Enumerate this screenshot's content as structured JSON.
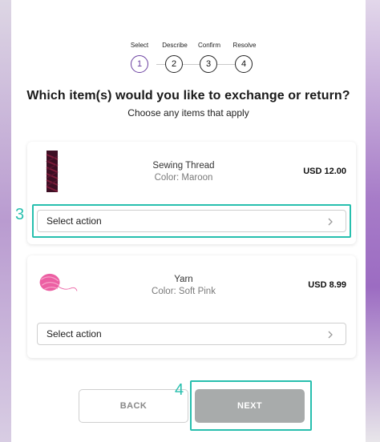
{
  "stepper": {
    "steps": [
      {
        "label": "Select",
        "number": "1",
        "active": true
      },
      {
        "label": "Describe",
        "number": "2",
        "active": false
      },
      {
        "label": "Confirm",
        "number": "3",
        "active": false
      },
      {
        "label": "Resolve",
        "number": "4",
        "active": false
      }
    ]
  },
  "page": {
    "title": "Which item(s) would you like to exchange or return?",
    "subtitle": "Choose any items that apply"
  },
  "items": [
    {
      "name": "Sewing Thread",
      "color": "Color: Maroon",
      "price": "USD 12.00",
      "action": "Select action",
      "thumb_icon": "maroon-thread-spool"
    },
    {
      "name": "Yarn",
      "color": "Color: Soft Pink",
      "price": "USD 8.99",
      "action": "Select action",
      "thumb_icon": "pink-yarn-ball"
    }
  ],
  "annotations": {
    "select_action_callout": "3",
    "next_callout": "4",
    "highlight_color": "#27bfae"
  },
  "footer": {
    "back_label": "BACK",
    "next_label": "NEXT"
  },
  "colors": {
    "active_step": "#6a3fa0",
    "next_button_bg": "#a8abab"
  }
}
